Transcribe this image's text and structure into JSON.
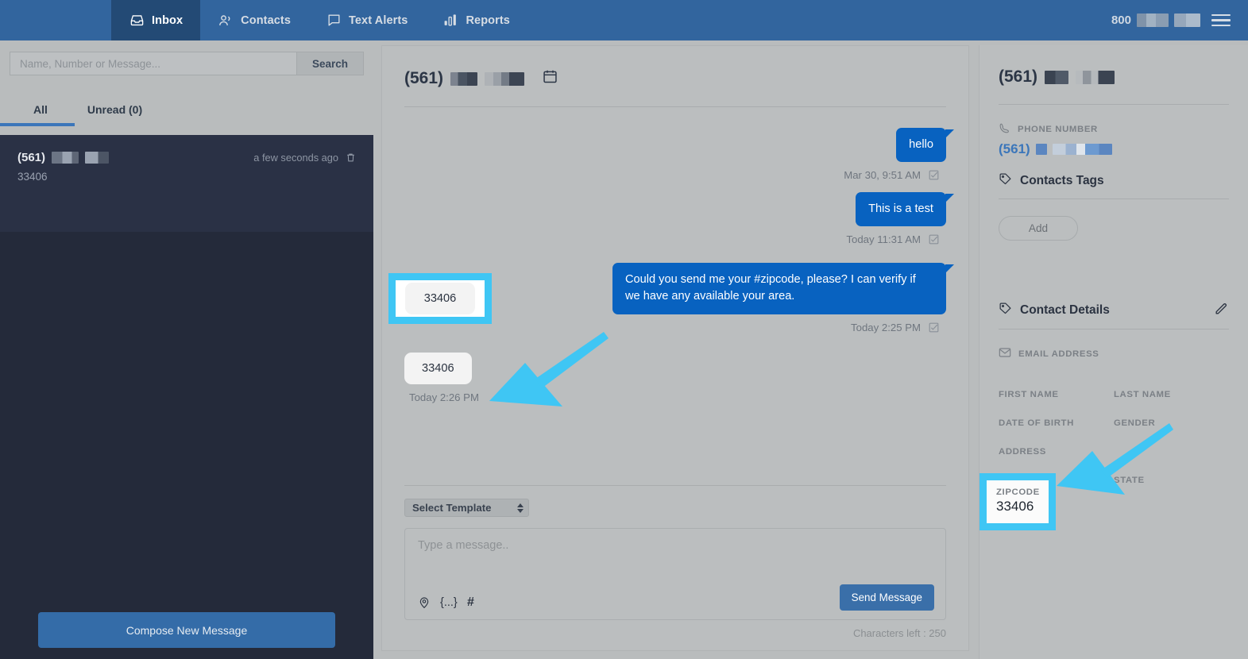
{
  "topnav": {
    "items": [
      {
        "label": "Inbox",
        "icon": "inbox-icon",
        "active": true
      },
      {
        "label": "Contacts",
        "icon": "contacts-icon",
        "active": false
      },
      {
        "label": "Text Alerts",
        "icon": "chat-bubble-icon",
        "active": false
      },
      {
        "label": "Reports",
        "icon": "bar-chart-icon",
        "active": false
      }
    ],
    "account_prefix": "800",
    "menu_icon": "hamburger-menu-icon"
  },
  "sidebar": {
    "search": {
      "placeholder": "Name, Number or Message...",
      "value": "",
      "button_label": "Search"
    },
    "tabs": [
      {
        "label": "All",
        "active": true
      },
      {
        "label": "Unread (0)",
        "active": false
      }
    ],
    "conversations": [
      {
        "name_prefix": "(561)",
        "time": "a few seconds ago",
        "preview": "33406",
        "delete_icon": "trash-icon"
      }
    ],
    "compose_label": "Compose New Message"
  },
  "conversation": {
    "header_phone_prefix": "(561)",
    "calendar_icon": "calendar-icon",
    "messages": [
      {
        "direction": "out",
        "text": "hello",
        "timestamp": "Mar 30, 9:51 AM",
        "status_icon": "delivered-check-icon"
      },
      {
        "direction": "out",
        "text": "This is a test",
        "timestamp": "Today 11:31 AM",
        "status_icon": "delivered-check-icon"
      },
      {
        "direction": "out",
        "text": "Could you send me your #zipcode, please? I can verify if we have any available your area.",
        "timestamp": "Today 2:25 PM",
        "status_icon": "delivered-check-icon"
      },
      {
        "direction": "in",
        "text": "33406",
        "timestamp": "Today 2:26 PM",
        "status_icon": ""
      }
    ],
    "template_select": {
      "label": "Select Template"
    },
    "composer": {
      "placeholder": "Type a message..",
      "value": "",
      "tools": [
        "location-pin-icon",
        "merge-field-icon",
        "hashtag-icon"
      ],
      "send_label": "Send Message",
      "characters_left": "Characters left : 250"
    }
  },
  "contact_panel": {
    "phone_prefix": "(561)",
    "phone_number_label": "PHONE NUMBER",
    "phone_number_icon": "phone-icon",
    "phone_value_prefix": "(561)",
    "tags_title": "Contacts Tags",
    "tags_icon": "tag-icon",
    "add_label": "Add",
    "details_title": "Contact Details",
    "details_icon": "tag-icon",
    "edit_icon": "pencil-edit-icon",
    "email_label": "EMAIL ADDRESS",
    "email_icon": "envelope-icon",
    "fields": [
      {
        "label": "FIRST NAME",
        "value": ""
      },
      {
        "label": "LAST NAME",
        "value": ""
      },
      {
        "label": "DATE OF BIRTH",
        "value": ""
      },
      {
        "label": "GENDER",
        "value": ""
      },
      {
        "label": "ADDRESS",
        "value": ""
      },
      {
        "label": "",
        "value": ""
      },
      {
        "label": "ZIPCODE",
        "value": "33406"
      },
      {
        "label": "STATE",
        "value": ""
      }
    ],
    "zip_label": "ZIPCODE",
    "zip_value": "33406",
    "state_label": "STATE"
  },
  "annotations": {
    "highlight_color": "#3fc6f4",
    "arrow_count": 2
  }
}
